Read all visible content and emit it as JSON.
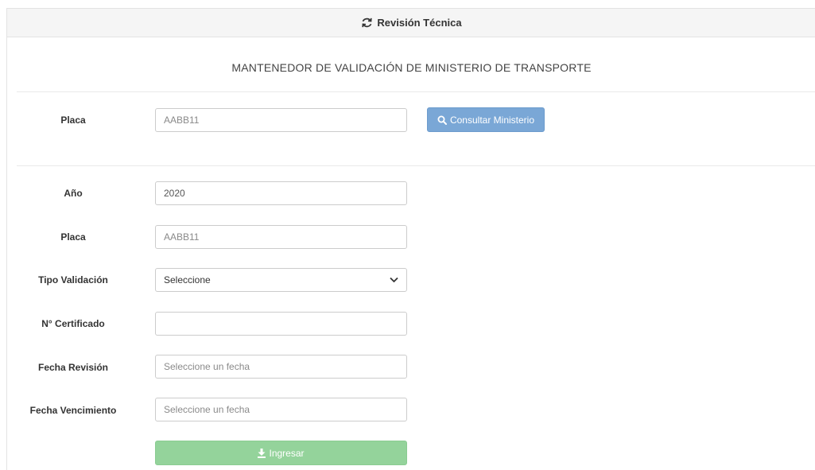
{
  "panel": {
    "title": "Revisión Técnica",
    "title_icon": "refresh-icon"
  },
  "subtitle": "MANTENEDOR DE VALIDACIÓN DE MINISTERIO DE TRANSPORTE",
  "search": {
    "label": "Placa",
    "placeholder": "AABB11",
    "value": "",
    "button_label": "Consultar Ministerio",
    "button_icon": "search-icon"
  },
  "form": {
    "anio": {
      "label": "Año",
      "value": "2020"
    },
    "placa": {
      "label": "Placa",
      "placeholder": "AABB11",
      "value": ""
    },
    "tipo_validacion": {
      "label": "Tipo Validación",
      "selected": "Seleccione"
    },
    "certificado": {
      "label": "N° Certificado",
      "value": ""
    },
    "fecha_revision": {
      "label": "Fecha Revisión",
      "placeholder": "Seleccione un fecha"
    },
    "fecha_vencimiento": {
      "label": "Fecha Vencimiento",
      "placeholder": "Seleccione un fecha"
    },
    "submit_label": "Ingresar",
    "submit_icon": "download-icon"
  },
  "colors": {
    "consult_button": "#7aa7d6",
    "submit_button": "#94d39b"
  }
}
